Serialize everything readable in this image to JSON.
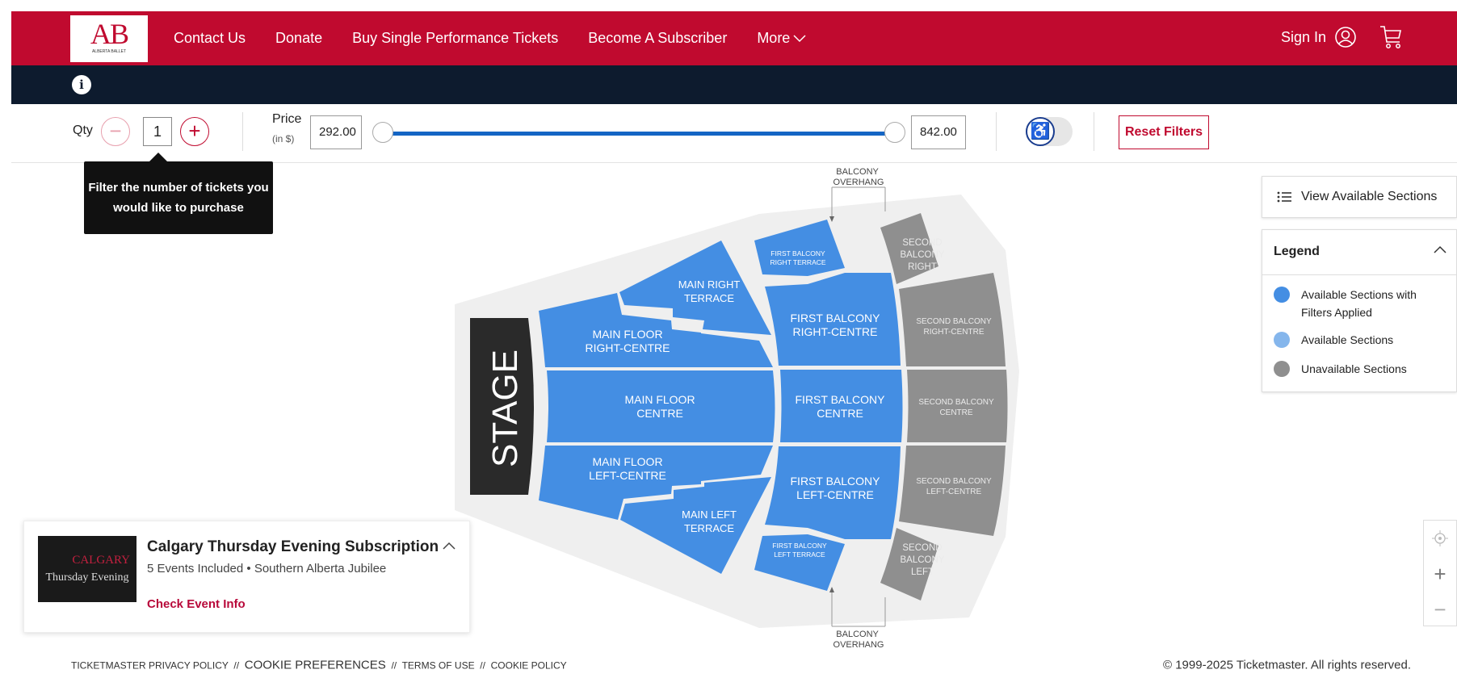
{
  "header": {
    "logo_text": "ALBERTA BALLET",
    "nav": [
      "Contact Us",
      "Donate",
      "Buy Single Performance Tickets",
      "Become A Subscriber",
      "More"
    ],
    "sign_in": "Sign In",
    "colors": {
      "brand": "#c00a2f",
      "infobar": "#0d1b2e"
    }
  },
  "info_icon": "i",
  "filters": {
    "qty_label": "Qty",
    "qty_value": "1",
    "price_label": "Price",
    "price_unit": "(in $)",
    "price_min": "292.00",
    "price_max": "842.00",
    "accessibility_icon": "wheelchair-icon",
    "accessibility_on": false,
    "reset_label": "Reset Filters"
  },
  "tooltip": {
    "line1": "Filter the number of tickets you",
    "line2": "would like to purchase"
  },
  "seatmap": {
    "stage": "STAGE",
    "overhang_top": [
      "BALCONY",
      "OVERHANG"
    ],
    "overhang_bottom": [
      "BALCONY",
      "OVERHANG"
    ],
    "colors": {
      "available_filtered": "#448ee3",
      "available": "#85b6ec",
      "unavailable": "#8f8f8f"
    },
    "sections": {
      "main_right_terrace": [
        "MAIN RIGHT",
        "TERRACE"
      ],
      "main_floor_right_centre": [
        "MAIN FLOOR",
        "RIGHT-CENTRE"
      ],
      "main_floor_centre": [
        "MAIN FLOOR",
        "CENTRE"
      ],
      "main_floor_left_centre": [
        "MAIN FLOOR",
        "LEFT-CENTRE"
      ],
      "main_left_terrace": [
        "MAIN LEFT",
        "TERRACE"
      ],
      "first_balcony_right_terrace": [
        "FIRST BALCONY",
        "RIGHT TERRACE"
      ],
      "first_balcony_right_centre": [
        "FIRST BALCONY",
        "RIGHT-CENTRE"
      ],
      "first_balcony_centre": [
        "FIRST BALCONY",
        "CENTRE"
      ],
      "first_balcony_left_centre": [
        "FIRST BALCONY",
        "LEFT-CENTRE"
      ],
      "first_balcony_left_terrace": [
        "FIRST BALCONY",
        "LEFT TERRACE"
      ],
      "second_balcony_right": [
        "SECOND",
        "BALCONY",
        "RIGHT"
      ],
      "second_balcony_right_centre": [
        "SECOND BALCONY",
        "RIGHT-CENTRE"
      ],
      "second_balcony_centre": [
        "SECOND BALCONY",
        "CENTRE"
      ],
      "second_balcony_left_centre": [
        "SECOND BALCONY",
        "LEFT-CENTRE"
      ],
      "second_balcony_left": [
        "SECOND",
        "BALCONY",
        "LEFT"
      ]
    }
  },
  "panel": {
    "view_sections": "View Available Sections",
    "legend_title": "Legend",
    "legend": [
      {
        "label": "Available Sections with Filters Applied",
        "color": "#448ee3"
      },
      {
        "label": "Available Sections",
        "color": "#85b6ec"
      },
      {
        "label": "Unavailable Sections",
        "color": "#8f8f8f"
      }
    ]
  },
  "event": {
    "thumb_line1": "CALGARY",
    "thumb_line2": "Thursday Evening",
    "title": "Calgary Thursday Evening Subscription",
    "subtitle": "5 Events Included • Southern Alberta Jubilee",
    "link": "Check Event Info"
  },
  "footer": {
    "privacy": "TICKETMASTER PRIVACY POLICY",
    "sep": "//",
    "cookie_pref": "COOKIE PREFERENCES",
    "terms": "TERMS OF USE",
    "cookie_policy": "COOKIE POLICY",
    "copyright": "© 1999-2025 Ticketmaster. All rights reserved."
  }
}
